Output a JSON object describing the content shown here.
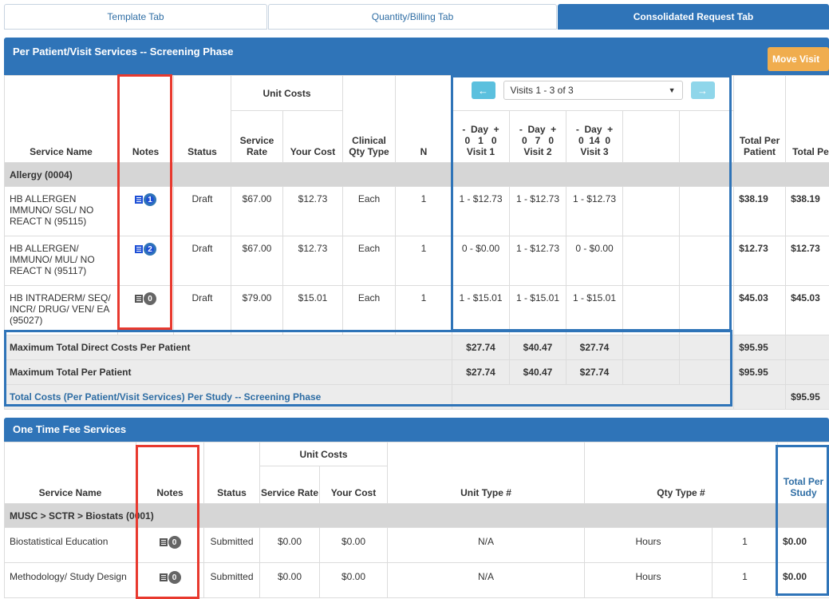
{
  "tabs": [
    "Template Tab",
    "Quantity/Billing Tab",
    "Consolidated Request Tab"
  ],
  "panel1": {
    "title": "Per Patient/Visit Services -- Screening Phase",
    "move_visit": "Move Visit",
    "headers": {
      "service_name": "Service Name",
      "notes": "Notes",
      "status": "Status",
      "unit_costs": "Unit Costs",
      "service_rate": "Service Rate",
      "your_cost": "Your Cost",
      "clinical_qty": "Clinical Qty Type",
      "n": "N",
      "total_per_patient": "Total Per Patient",
      "total_per_study": "Total Per Study"
    },
    "visit_select": "Visits 1 - 3 of 3",
    "visits": [
      {
        "day": "-  Day  +\n0   1   0",
        "label": "Visit 1"
      },
      {
        "day": "-  Day  +\n0   7   0",
        "label": "Visit 2"
      },
      {
        "day": "-  Day  +\n0  14  0",
        "label": "Visit 3"
      }
    ],
    "group": "Allergy (0004)",
    "rows": [
      {
        "name": "HB ALLERGEN IMMUNO/ SGL/ NO REACT N (95115)",
        "notes": "1",
        "status": "Draft",
        "rate": "$67.00",
        "cost": "$12.73",
        "qty": "Each",
        "n": "1",
        "v1": "1 - $12.73",
        "v2": "1 - $12.73",
        "v3": "1 - $12.73",
        "tpp": "$38.19",
        "tps": "$38.19"
      },
      {
        "name": "HB ALLERGEN/ IMMUNO/ MUL/ NO REACT N (95117)",
        "notes": "2",
        "status": "Draft",
        "rate": "$67.00",
        "cost": "$12.73",
        "qty": "Each",
        "n": "1",
        "v1": "0 - $0.00",
        "v2": "1 - $12.73",
        "v3": "0 - $0.00",
        "tpp": "$12.73",
        "tps": "$12.73"
      },
      {
        "name": "HB INTRADERM/ SEQ/ INCR/ DRUG/ VEN/ EA (95027)",
        "notes": "0",
        "status": "Draft",
        "rate": "$79.00",
        "cost": "$15.01",
        "qty": "Each",
        "n": "1",
        "v1": "1 - $15.01",
        "v2": "1 - $15.01",
        "v3": "1 - $15.01",
        "tpp": "$45.03",
        "tps": "$45.03"
      }
    ],
    "summary": [
      {
        "label": "Maximum Total Direct Costs Per Patient",
        "v1": "$27.74",
        "v2": "$40.47",
        "v3": "$27.74",
        "tpp": "$95.95",
        "tps": ""
      },
      {
        "label": "Maximum Total Per Patient",
        "v1": "$27.74",
        "v2": "$40.47",
        "v3": "$27.74",
        "tpp": "$95.95",
        "tps": ""
      }
    ],
    "total_link": "Total Costs (Per Patient/Visit Services) Per Study -- Screening Phase",
    "total_value": "$95.95"
  },
  "panel2": {
    "title": "One Time Fee Services",
    "headers": {
      "service_name": "Service Name",
      "notes": "Notes",
      "status": "Status",
      "unit_costs": "Unit Costs",
      "service_rate": "Service Rate",
      "your_cost": "Your Cost",
      "unit_type": "Unit Type #",
      "qty_type": "Qty Type #",
      "total_per_study": "Total Per Study"
    },
    "group": "MUSC > SCTR > Biostats (0001)",
    "rows": [
      {
        "name": "Biostatistical Education",
        "notes": "0",
        "status": "Submitted",
        "rate": "$0.00",
        "cost": "$0.00",
        "unit_type": "N/A",
        "qty_type": "Hours",
        "qty": "1",
        "tps": "$0.00"
      },
      {
        "name": "Methodology/ Study Design",
        "notes": "0",
        "status": "Submitted",
        "rate": "$0.00",
        "cost": "$0.00",
        "unit_type": "N/A",
        "qty_type": "Hours",
        "qty": "1",
        "tps": "$0.00"
      }
    ]
  },
  "colors": {
    "primary": "#2f74b8",
    "warning": "#f0ad4e",
    "info": "#5bc0de",
    "highlight_red": "#e8392e",
    "badge_blue": "#1d4fd6"
  }
}
